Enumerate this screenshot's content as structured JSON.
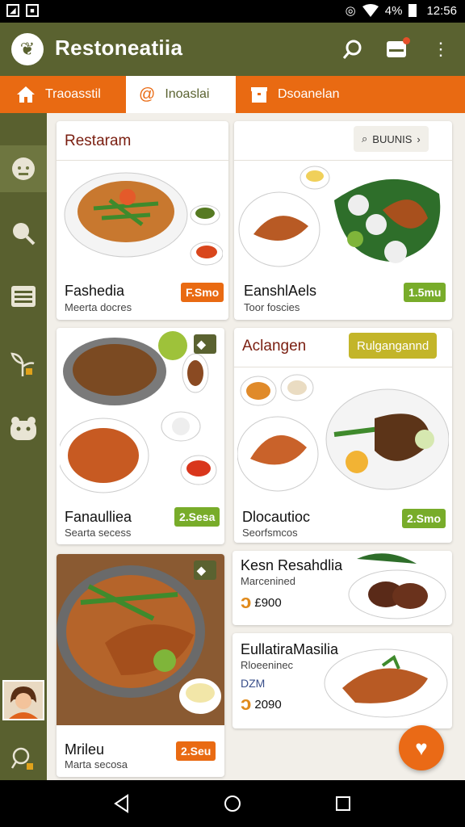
{
  "status_bar": {
    "battery_pct": "4%",
    "time": "12:56"
  },
  "app_bar": {
    "title": "Restoneatiia"
  },
  "tabs": [
    {
      "label": "Traoasstil",
      "icon": "home-icon"
    },
    {
      "label": "Inoaslai",
      "icon": "at-icon"
    },
    {
      "label": "Dsoanelan",
      "icon": "box-icon"
    }
  ],
  "cards": [
    {
      "header": "Restaram",
      "name": "Fashedia",
      "subtitle": "Meerta docres",
      "badge": "F.Smo"
    },
    {
      "chip": "BUUNIS",
      "name": "EanshlAels",
      "subtitle": "Toor foscies",
      "badge": "1.5mu"
    },
    {
      "name": "Fanaulliea",
      "subtitle": "Searta secess",
      "badge": "2.Sesa"
    },
    {
      "header": "Aclangen",
      "chip": "Rulgangannd",
      "name": "Dlocautioc",
      "subtitle": "Seorfsmcos",
      "badge": "2.Smo"
    },
    {
      "name": "Mrileu",
      "subtitle": "Marta secosa",
      "badge": "2.Seu"
    },
    {
      "name": "Kesn Resahdlia",
      "subtitle": "Marcenined",
      "price": "£900"
    },
    {
      "name": "EullatiraMasilia",
      "subtitle": "Rloeeninec",
      "extra": "DZM",
      "price": "2090"
    }
  ],
  "colors": {
    "olive": "#5a6230",
    "orange": "#e96a12",
    "green_badge": "#78ac2a"
  }
}
